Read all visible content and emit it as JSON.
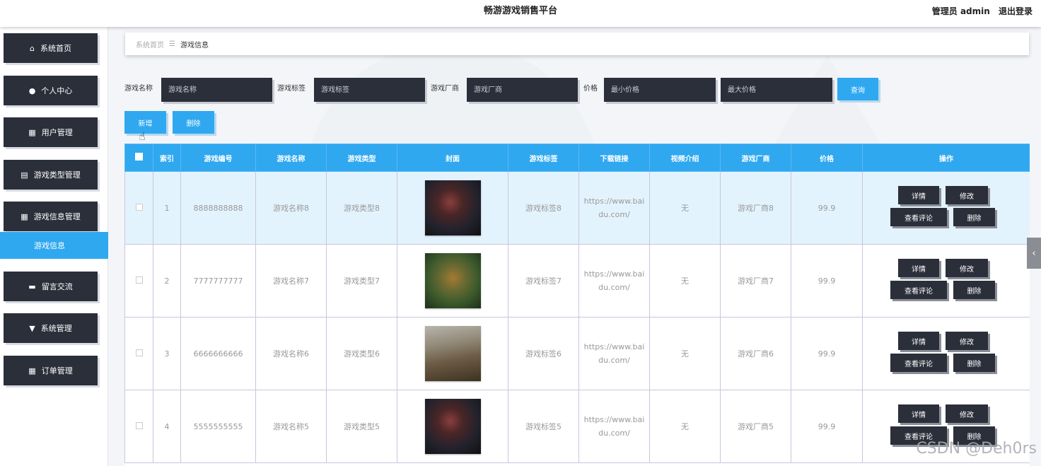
{
  "header": {
    "title": "畅游游戏销售平台",
    "user_label": "管理员 admin",
    "logout": "退出登录"
  },
  "sidebar": {
    "items": [
      {
        "icon": "home-icon",
        "glyph": "⌂",
        "label": "系统首页"
      },
      {
        "icon": "user-icon",
        "glyph": "●",
        "label": "个人中心"
      },
      {
        "icon": "grid-icon",
        "glyph": "▦",
        "label": "用户管理"
      },
      {
        "icon": "clipboard-icon",
        "glyph": "▤",
        "label": "游戏类型管理"
      },
      {
        "icon": "grid-icon",
        "glyph": "▦",
        "label": "游戏信息管理"
      },
      {
        "icon": "chat-icon",
        "glyph": "▬",
        "label": "留言交流"
      },
      {
        "icon": "settings-icon",
        "glyph": "▼",
        "label": "系统管理"
      },
      {
        "icon": "grid-icon",
        "glyph": "▦",
        "label": "订单管理"
      }
    ],
    "active_sub": "游戏信息"
  },
  "breadcrumb": {
    "home": "系统首页",
    "separator": "☰",
    "current": "游戏信息"
  },
  "search": {
    "name_label": "游戏名称",
    "name_placeholder": "游戏名称",
    "tag_label": "游戏标签",
    "tag_placeholder": "游戏标签",
    "vendor_label": "游戏厂商",
    "vendor_placeholder": "游戏厂商",
    "price_label": "价格",
    "min_price_placeholder": "最小价格",
    "max_price_placeholder": "最大价格",
    "query_button": "查询"
  },
  "actions": {
    "add": "新增",
    "delete": "删除"
  },
  "table": {
    "headers": [
      "索引",
      "游戏编号",
      "游戏名称",
      "游戏类型",
      "封面",
      "游戏标签",
      "下载链接",
      "视频介绍",
      "游戏厂商",
      "价格",
      "操作"
    ],
    "rows": [
      {
        "index": "1",
        "code": "8888888888",
        "name": "游戏名称8",
        "type": "游戏类型8",
        "cover": "cover-dark",
        "tag": "游戏标签8",
        "link": "https://www.baidu.com/",
        "video": "无",
        "vendor": "游戏厂商8",
        "price": "99.9"
      },
      {
        "index": "2",
        "code": "7777777777",
        "name": "游戏名称7",
        "type": "游戏类型7",
        "cover": "cover-green",
        "tag": "游戏标签7",
        "link": "https://www.baidu.com/",
        "video": "无",
        "vendor": "游戏厂商7",
        "price": "99.9"
      },
      {
        "index": "3",
        "code": "6666666666",
        "name": "游戏名称6",
        "type": "游戏类型6",
        "cover": "cover-town",
        "tag": "游戏标签6",
        "link": "https://www.baidu.com/",
        "video": "无",
        "vendor": "游戏厂商6",
        "price": "99.9"
      },
      {
        "index": "4",
        "code": "5555555555",
        "name": "游戏名称5",
        "type": "游戏类型5",
        "cover": "cover-dark",
        "tag": "游戏标签5",
        "link": "https://www.baidu.com/",
        "video": "无",
        "vendor": "游戏厂商5",
        "price": "99.9"
      }
    ],
    "row_actions": {
      "detail": "详情",
      "edit": "修改",
      "comments": "查看评论",
      "delete": "删除"
    }
  },
  "watermark": "CSDN @Deh0rs",
  "right_tab": "‹",
  "colors": {
    "accent": "#2fa8f0",
    "dark": "#2b2f3a",
    "highlight_row": "#e3f3fd"
  }
}
